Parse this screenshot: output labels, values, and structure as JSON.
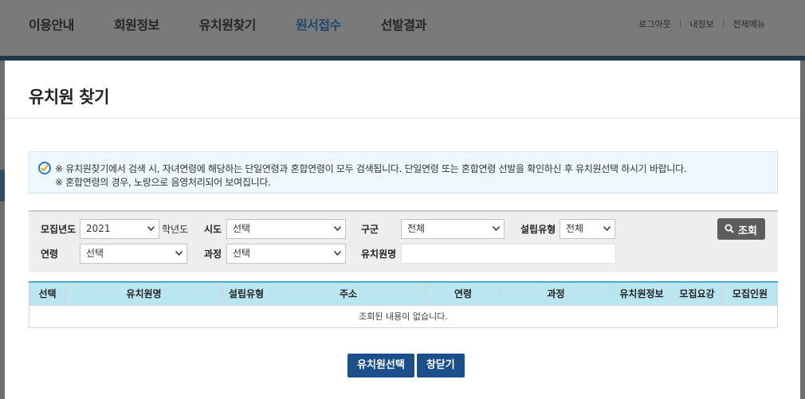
{
  "topnav": {
    "menu": [
      {
        "label": "이용안내"
      },
      {
        "label": "회원정보"
      },
      {
        "label": "유치원찾기"
      },
      {
        "label": "원서접수"
      },
      {
        "label": "선발결과"
      }
    ],
    "util": {
      "logout": "로그아웃",
      "myinfo": "내정보",
      "allmenu": "전체메뉴"
    }
  },
  "modal": {
    "title": "유치원 찾기",
    "notice": {
      "line1": "※ 유치원찾기에서 검색 시, 자녀연령에 해당하는 단일연령과 혼합연령이 모두 검색됩니다. 단일연령 또는 혼합연령 선발을 확인하신 후 유치원선택 하시기 바랍니다.",
      "line2": "※ 혼합연령의 경우, 노랑으로 음영처리되어 보여집니다."
    },
    "search": {
      "year_label": "모집년도",
      "year_value": "2021",
      "year_suffix": "학년도",
      "sido_label": "시도",
      "sido_value": "선택",
      "gugun_label": "구군",
      "gugun_value": "전체",
      "type_label": "설립유형",
      "type_value": "전체",
      "age_label": "연령",
      "age_value": "선택",
      "course_label": "과정",
      "course_value": "선택",
      "name_label": "유치원명",
      "name_value": "",
      "search_button": "조회"
    },
    "table": {
      "headers": [
        "선택",
        "유치원명",
        "설립유형",
        "주소",
        "연령",
        "과정",
        "유치원정보",
        "모집요강",
        "모집인원"
      ],
      "empty_message": "조회된 내용이 없습니다."
    },
    "buttons": {
      "select": "유치원선택",
      "close": "창닫기"
    }
  },
  "colors": {
    "accent": "#1b4f8c",
    "table_header": "#b9e6f1",
    "notice_bg": "#eef8fc"
  }
}
